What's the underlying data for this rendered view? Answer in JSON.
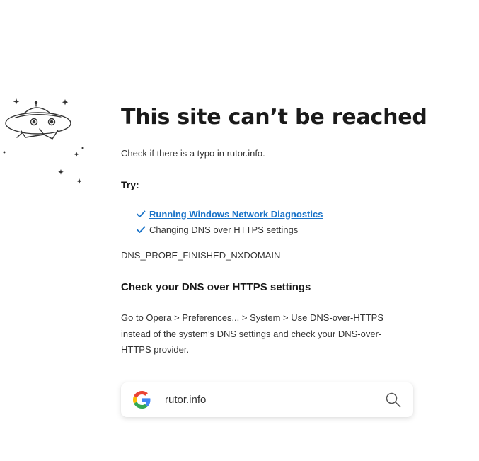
{
  "error_page": {
    "title": "This site can’t be reached",
    "typo_hint": "Check if there is a typo in rutor.info.",
    "try_label": "Try:",
    "suggestions": {
      "diagnostics_link": "Running Windows Network Diagnostics",
      "dns_https": "Changing DNS over HTTPS settings"
    },
    "error_code": "DNS_PROBE_FINISHED_NXDOMAIN",
    "dns_heading": "Check your DNS over HTTPS settings",
    "dns_description": "Go to Opera > Preferences... > System > Use DNS-over-HTTPS instead of the system’s DNS settings and check your DNS-over-HTTPS provider."
  },
  "search": {
    "engine_icon": "google-g-logo",
    "query": "rutor.info",
    "action_icon": "search-icon"
  },
  "illustration": {
    "icon": "ufo-icon"
  },
  "colors": {
    "link": "#1a73c8",
    "check": "#1a73c8",
    "text": "#333333",
    "heading": "#1a1a1a"
  }
}
